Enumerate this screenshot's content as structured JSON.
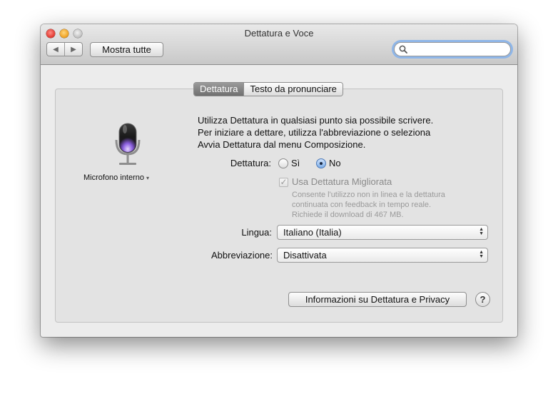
{
  "window": {
    "title": "Dettatura e Voce"
  },
  "toolbar": {
    "back_icon": "◀",
    "forward_icon": "▶",
    "show_all_label": "Mostra tutte",
    "search_value": "",
    "search_placeholder": ""
  },
  "tabs": [
    {
      "label": "Dettatura",
      "selected": true
    },
    {
      "label": "Testo da pronunciare",
      "selected": false
    }
  ],
  "mic": {
    "label": "Microfono interno",
    "menu_indicator": "▾"
  },
  "description": [
    "Utilizza Dettatura in qualsiasi punto sia possibile scrivere.",
    "Per iniziare a dettare, utilizza l'abbreviazione o seleziona",
    "Avvia Dettatura dal menu Composizione."
  ],
  "dictation": {
    "label": "Dettatura:",
    "options": [
      {
        "label": "Sì",
        "selected": false
      },
      {
        "label": "No",
        "selected": true
      }
    ]
  },
  "enhanced": {
    "label": "Usa Dettatura Migliorata",
    "checked": true,
    "enabled": false,
    "note": [
      "Consente l'utilizzo non in linea e la dettatura",
      "continuata con feedback in tempo reale.",
      "Richiede il download di 467 MB."
    ]
  },
  "language": {
    "label": "Lingua:",
    "value": "Italiano (Italia)"
  },
  "shortcut": {
    "label": "Abbreviazione:",
    "value": "Disattivata"
  },
  "buttons": {
    "privacy_label": "Informazioni su Dettatura e Privacy",
    "help_label": "?"
  },
  "colors": {
    "close": "#e33b32",
    "minimize": "#f0a324",
    "zoom": "#c2c2c2",
    "accent": "#4a78b8",
    "mic_glow": "#8b5fe0"
  }
}
